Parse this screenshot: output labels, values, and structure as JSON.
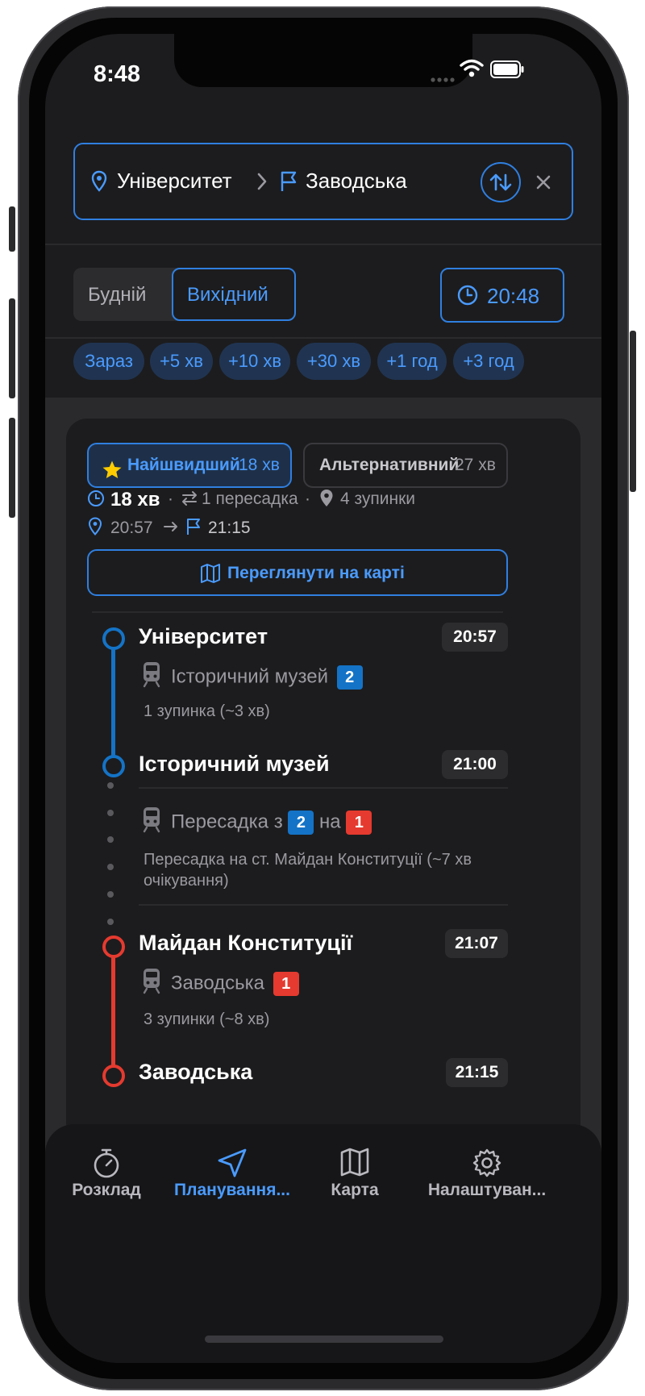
{
  "status_bar": {
    "time": "8:48"
  },
  "route": {
    "from": "Університет",
    "to": "Заводська"
  },
  "day_toggle": {
    "options": [
      "Будній",
      "Вихідний"
    ],
    "selected": "Вихідний"
  },
  "departure_time": "20:48",
  "time_chips": [
    "Зараз",
    "+5 хв",
    "+10 хв",
    "+30 хв",
    "+1 год",
    "+3 год"
  ],
  "options": [
    {
      "label": "Найшвидший",
      "duration": "18 хв",
      "selected": true
    },
    {
      "label": "Альтернативний",
      "duration": "27 хв",
      "selected": false
    }
  ],
  "summary": {
    "duration": "18 хв",
    "transfers": "1 пересадка",
    "stops": "4 зупинки",
    "depart": "20:57",
    "arrive": "21:15"
  },
  "map_button": "Переглянути на карті",
  "steps": {
    "stop1": {
      "name": "Університет",
      "time": "20:57"
    },
    "leg1": {
      "direction": "Історичний музей",
      "line": "2",
      "info": "1 зупинка (~3 хв)"
    },
    "stop2": {
      "name": "Історичний музей",
      "time": "21:00"
    },
    "transfer": {
      "from_text": "Пересадка з",
      "mid": "на",
      "from_line": "2",
      "to_line": "1",
      "info_line1": "Пересадка на ст. Майдан Конституції (~7 хв",
      "info_line2": "очікування)"
    },
    "stop3": {
      "name": "Майдан Конституції",
      "time": "21:07"
    },
    "leg2": {
      "direction": "Заводська",
      "line": "1",
      "info": "3 зупинки (~8 хв)"
    },
    "stop4": {
      "name": "Заводська",
      "time": "21:15"
    }
  },
  "tabs": [
    {
      "label": "Розклад",
      "icon": "stopwatch-icon",
      "active": false
    },
    {
      "label": "Планування...",
      "icon": "navigation-arrow-icon",
      "active": true
    },
    {
      "label": "Карта",
      "icon": "map-icon",
      "active": false
    },
    {
      "label": "Налаштуван...",
      "icon": "gear-icon",
      "active": false
    }
  ],
  "colors": {
    "accent": "#2f7fe0",
    "line_blue": "#1473c6",
    "line_red": "#e53a2f",
    "background": "#1c1c1e"
  }
}
